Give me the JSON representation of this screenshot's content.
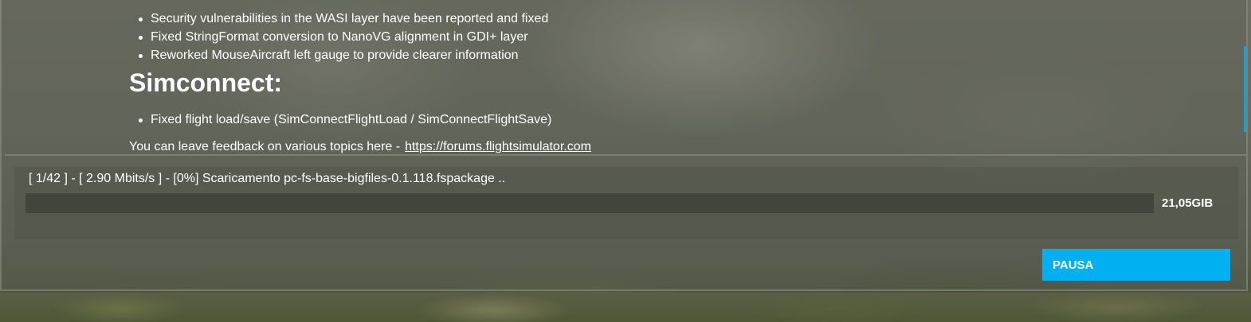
{
  "release_notes": {
    "items_top": [
      "Security vulnerabilities in the WASI layer have been reported and fixed",
      "Fixed StringFormat conversion to NanoVG alignment in GDI+ layer",
      "Reworked MouseAircraft left gauge to provide clearer information"
    ],
    "section_heading": "Simconnect:",
    "items_bottom": [
      "Fixed flight load/save (SimConnectFlightLoad / SimConnectFlightSave)"
    ],
    "feedback_text": "You can leave feedback on various topics here -",
    "feedback_link": "https://forums.flightsimulator.com"
  },
  "download": {
    "status": "[ 1/42 ] - [ 2.90 Mbits/s ] - [0%] Scaricamento pc-fs-base-bigfiles-0.1.118.fspackage ..",
    "progress_percent": 0,
    "total_size": "21,05GIB"
  },
  "actions": {
    "pause_label": "PAUSA"
  },
  "colors": {
    "accent": "#00b0f0"
  }
}
